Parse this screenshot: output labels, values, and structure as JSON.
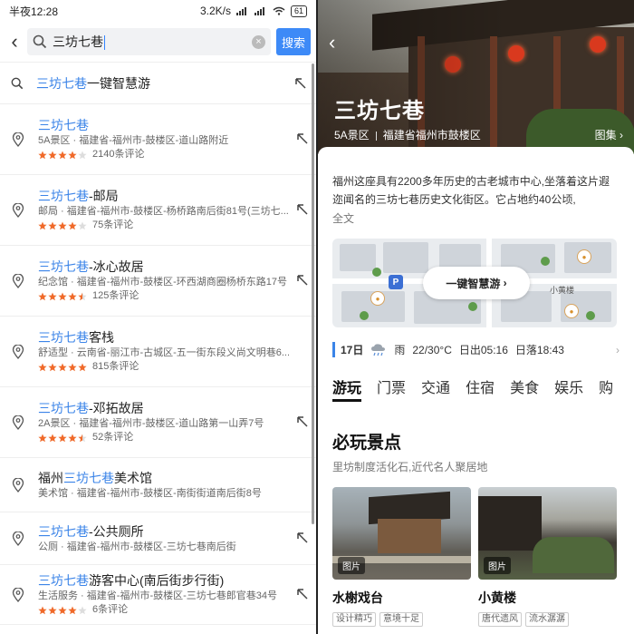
{
  "status_bar": {
    "time": "半夜12:28",
    "speed": "3.2K/s",
    "battery": "61"
  },
  "search": {
    "query": "三坊七巷",
    "button": "搜索"
  },
  "first_suggestion": {
    "hl": "三坊七巷",
    "rest": "一键智慧游"
  },
  "results": [
    {
      "pre": "",
      "hl": "三坊七巷",
      "post": "",
      "sub": "5A景区 · 福建省-福州市-鼓楼区-道山路附近",
      "stars": 4,
      "count": "2140条评论"
    },
    {
      "pre": "",
      "hl": "三坊七巷",
      "post": "-邮局",
      "sub": "邮局 · 福建省-福州市-鼓楼区-杨桥路南后街81号(三坊七...",
      "stars": 4,
      "count": "75条评论"
    },
    {
      "pre": "",
      "hl": "三坊七巷",
      "post": "-冰心故居",
      "sub": "纪念馆 · 福建省-福州市-鼓楼区-环西湖商圈杨桥东路17号",
      "stars": 4.5,
      "count": "125条评论"
    },
    {
      "pre": "",
      "hl": "三坊七巷",
      "post": "客栈",
      "sub": "舒适型 · 云南省-丽江市-古城区-五一街东段义尚文明巷6...",
      "stars": 5,
      "count": "815条评论"
    },
    {
      "pre": "",
      "hl": "三坊七巷",
      "post": "-邓拓故居",
      "sub": "2A景区 · 福建省-福州市-鼓楼区-道山路第一山弄7号",
      "stars": 4.5,
      "count": "52条评论"
    },
    {
      "pre": "福州",
      "hl": "三坊七巷",
      "post": "美术馆",
      "sub": "美术馆 · 福建省-福州市-鼓楼区-南街街道南后街8号",
      "stars": 0,
      "count": ""
    },
    {
      "pre": "",
      "hl": "三坊七巷",
      "post": "-公共厕所",
      "sub": "公厕 · 福建省-福州市-鼓楼区-三坊七巷南后街",
      "stars": 0,
      "count": ""
    },
    {
      "pre": "",
      "hl": "三坊七巷",
      "post": "游客中心(南后街步行街)",
      "sub": "生活服务 · 福建省-福州市-鼓楼区-三坊七巷郎官巷34号",
      "stars": 4,
      "count": "6条评论"
    }
  ],
  "detail": {
    "title": "三坊七巷",
    "level": "5A景区",
    "location": "福建省福州市鼓楼区",
    "gallery": "图集",
    "description": "福州这座具有2200多年历史的古老城市中心,坐落着这片遐迩闻名的三坊七巷历史文化街区。它占地约40公顷,",
    "full_text": "全文",
    "map_button": "一键智慧游",
    "map_label": "小黄楼",
    "weather": {
      "date": "17日",
      "condition": "雨",
      "temp": "22/30°C",
      "sunrise": "日出05:16",
      "sunset": "日落18:43"
    },
    "tabs": [
      "游玩",
      "门票",
      "交通",
      "住宿",
      "美食",
      "娱乐",
      "购"
    ],
    "section_title": "必玩景点",
    "section_sub": "里坊制度活化石,近代名人聚居地",
    "photo_tag": "图片",
    "spots": [
      {
        "name": "水榭戏台",
        "tags": [
          "设计精巧",
          "意境十足"
        ]
      },
      {
        "name": "小黄楼",
        "tags": [
          "唐代遗风",
          "流水潺潺"
        ]
      }
    ]
  },
  "colors": {
    "accent": "#3b84e8",
    "star": "#f06a2a",
    "search_button": "#3d8af7"
  }
}
